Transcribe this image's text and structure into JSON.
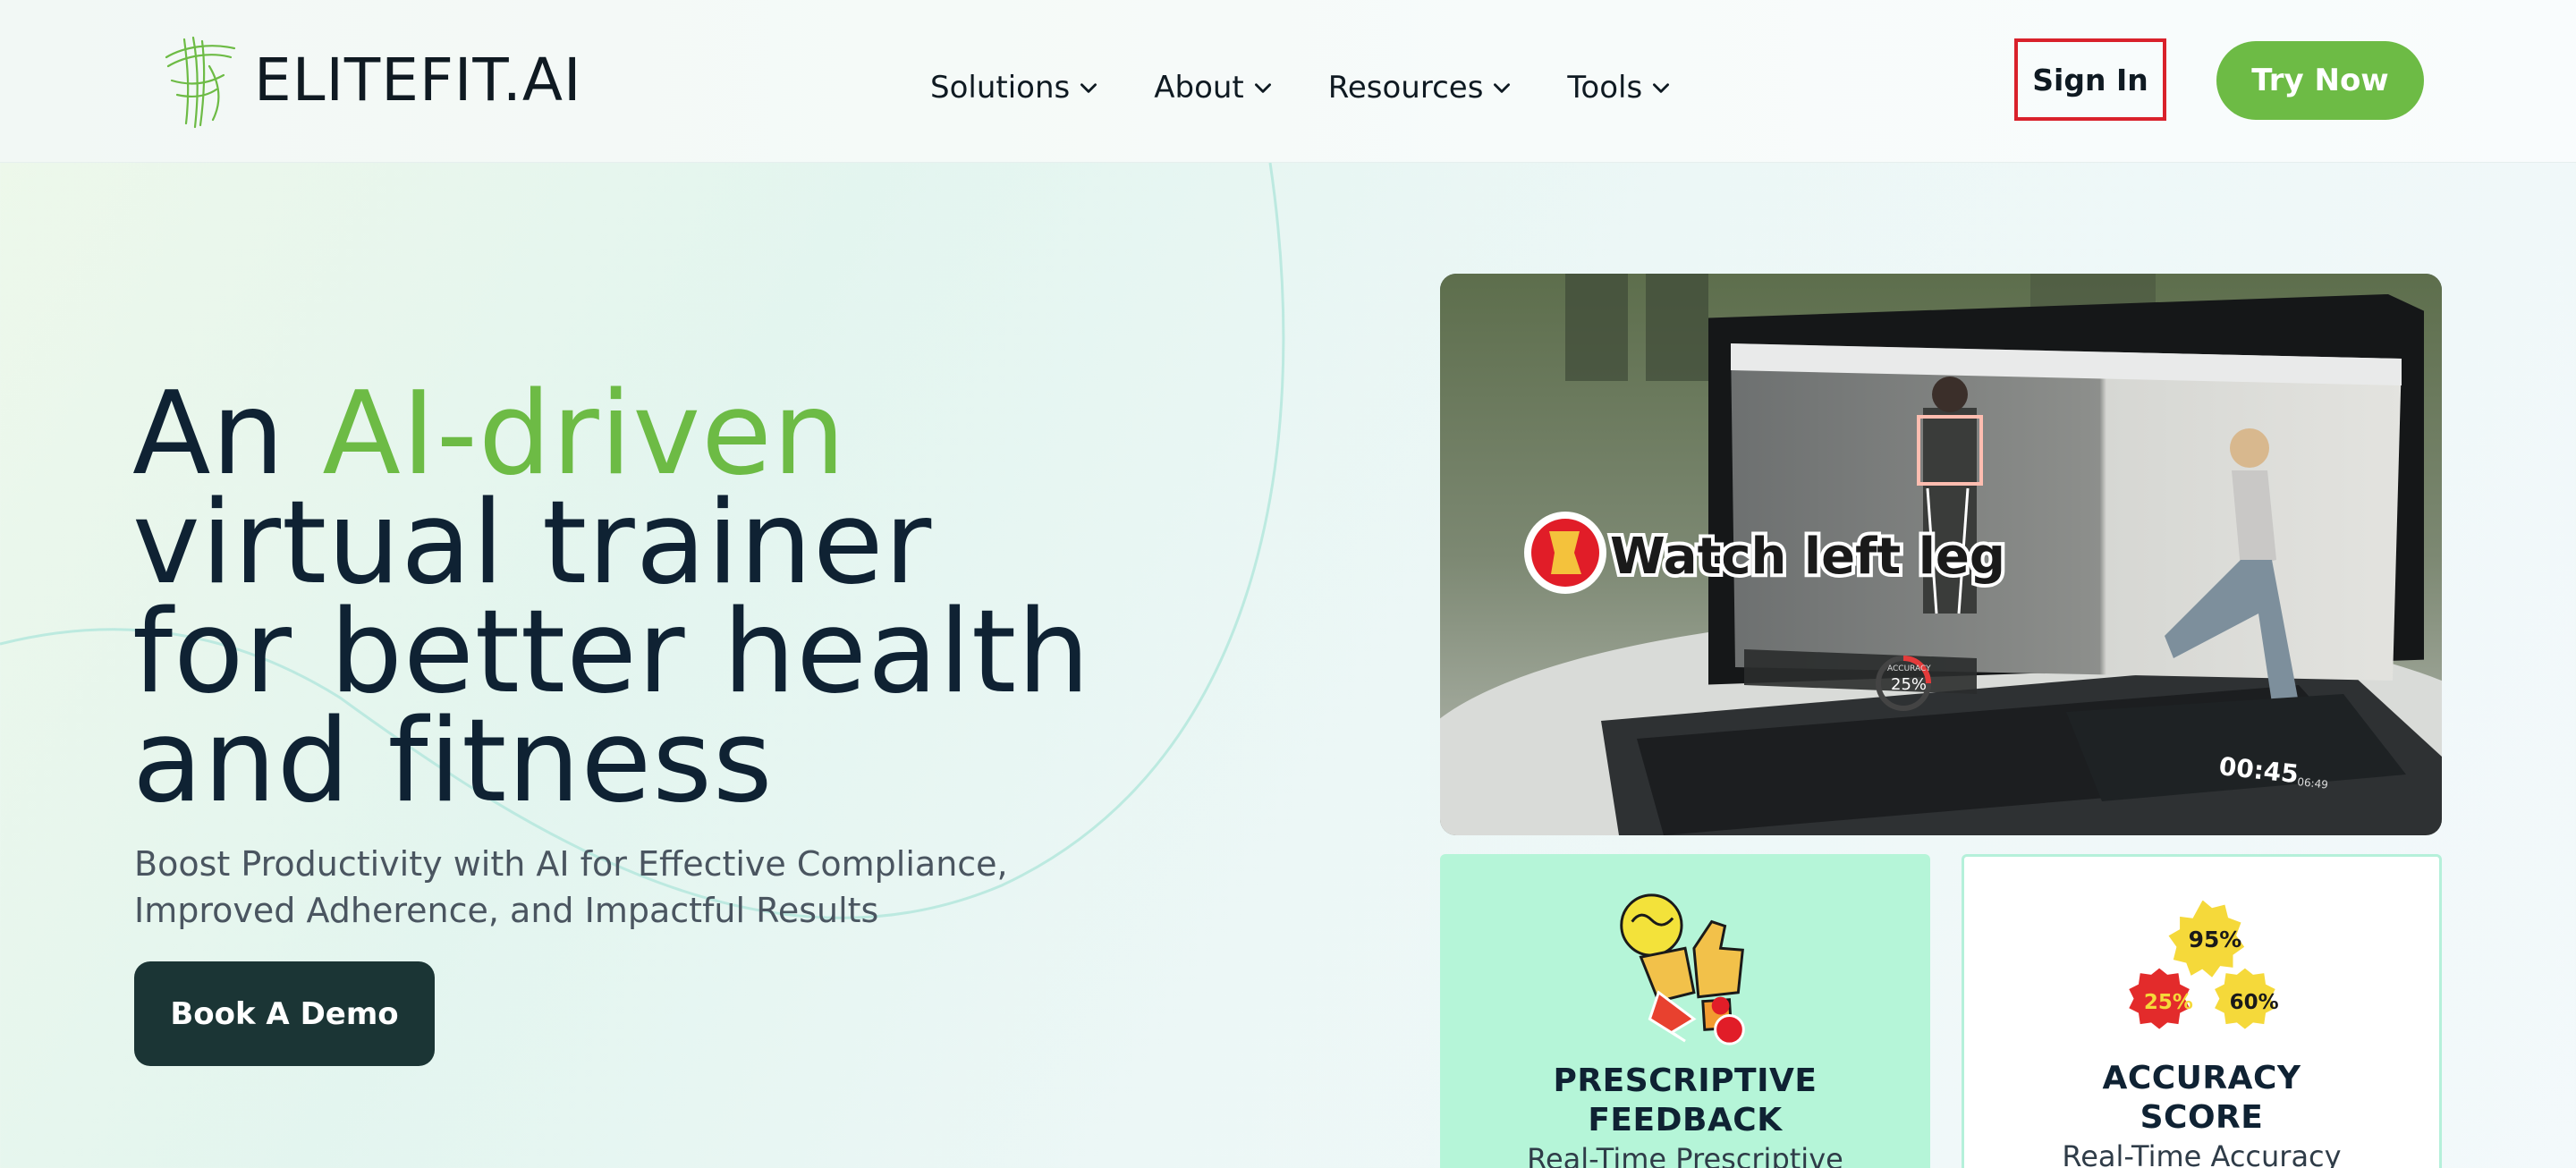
{
  "brand": {
    "name": "ELITEFIT.AI"
  },
  "nav": {
    "items": [
      {
        "label": "Solutions"
      },
      {
        "label": "About"
      },
      {
        "label": "Resources"
      },
      {
        "label": "Tools"
      }
    ]
  },
  "header": {
    "sign_in_label": "Sign In",
    "try_now_label": "Try Now"
  },
  "hero": {
    "title_pre": "An ",
    "title_accent": "AI-driven",
    "title_line2": "virtual trainer",
    "title_line3": "for better health",
    "title_line4": "and fitness",
    "subtitle_line1": "Boost Productivity with AI for Effective Compliance,",
    "subtitle_line2": "Improved Adherence, and Impactful Results",
    "cta_label": "Book A Demo"
  },
  "video": {
    "overlay_text": "Watch left leg",
    "timer": "00:45",
    "timer_total": "06:49",
    "accuracy_label": "ACCURACY",
    "accuracy_value": "25%"
  },
  "features": [
    {
      "title_line1": "PRESCRIPTIVE",
      "title_line2": "FEEDBACK",
      "desc": "Real-Time Prescriptive"
    },
    {
      "title_line1": "ACCURACY",
      "title_line2": "SCORE",
      "desc": "Real-Time Accuracy",
      "badges": [
        "95%",
        "25%",
        "60%"
      ]
    }
  ],
  "colors": {
    "accent": "#6dbb45",
    "dark_button": "#1b3535",
    "sign_in_outline": "#d9212b",
    "card_green": "#b5f5d8"
  }
}
